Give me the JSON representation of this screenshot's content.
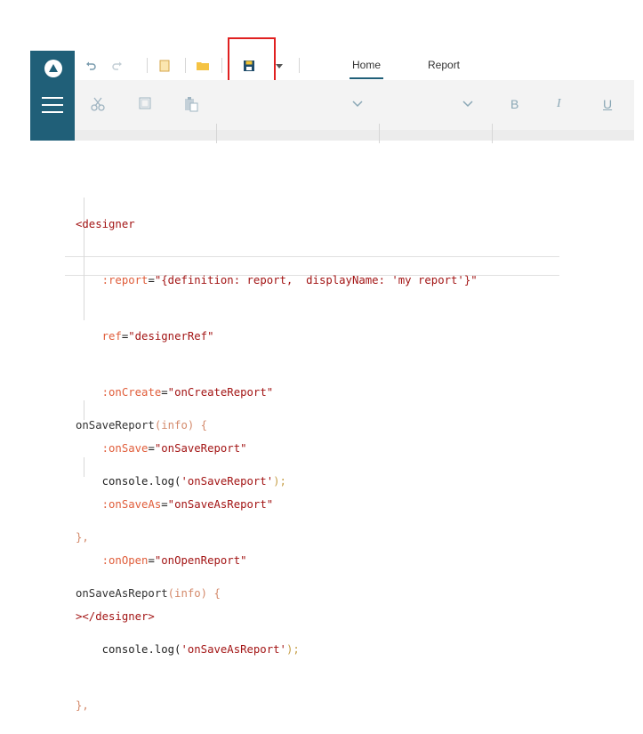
{
  "app": {
    "tabs": [
      {
        "label": "Home",
        "active": true
      },
      {
        "label": "Report",
        "active": false
      }
    ],
    "toolbar_icons": [
      "undo-icon",
      "redo-icon",
      "new-icon",
      "open-folder-icon",
      "save-icon",
      "dropdown-arrow-icon"
    ],
    "ribbon_icons": [
      "cut-icon",
      "copy-icon",
      "paste-icon",
      "font-dropdown-icon",
      "size-dropdown-icon"
    ],
    "format_buttons": {
      "bold": "B",
      "italic": "I",
      "underline": "U"
    },
    "colors": {
      "sidebar": "#205f78",
      "highlight": "#e02020",
      "ribbon": "#f3f3f3"
    }
  },
  "code_template": {
    "line1_tag": "<designer",
    "line2_attr": ":report",
    "line2_val": "\"{definition: report,  displayName: 'my report'}\"",
    "line3_attr": "ref",
    "line3_val": "\"designerRef\"",
    "line4_attr": ":onCreate",
    "line4_val": "\"onCreateReport\"",
    "line5_attr": ":onSave",
    "line5_val": "\"onSaveReport\"",
    "line6_attr": ":onSaveAs",
    "line6_val": "\"onSaveAsReport\"",
    "line7_attr": ":onOpen",
    "line7_val": "\"onOpenReport\"",
    "line8_close": "></designer>"
  },
  "code_script": {
    "f1_name": "onSaveReport",
    "f1_params": "(info) {",
    "f1_body_prefix": "console.log(",
    "f1_body_str": "'onSaveReport'",
    "f1_body_suffix": ");",
    "f1_close": "},",
    "f2_name": "onSaveAsReport",
    "f2_params": "(info) {",
    "f2_body_prefix": "console.log(",
    "f2_body_str": "'onSaveAsReport'",
    "f2_body_suffix": ");",
    "f2_close": "},"
  }
}
